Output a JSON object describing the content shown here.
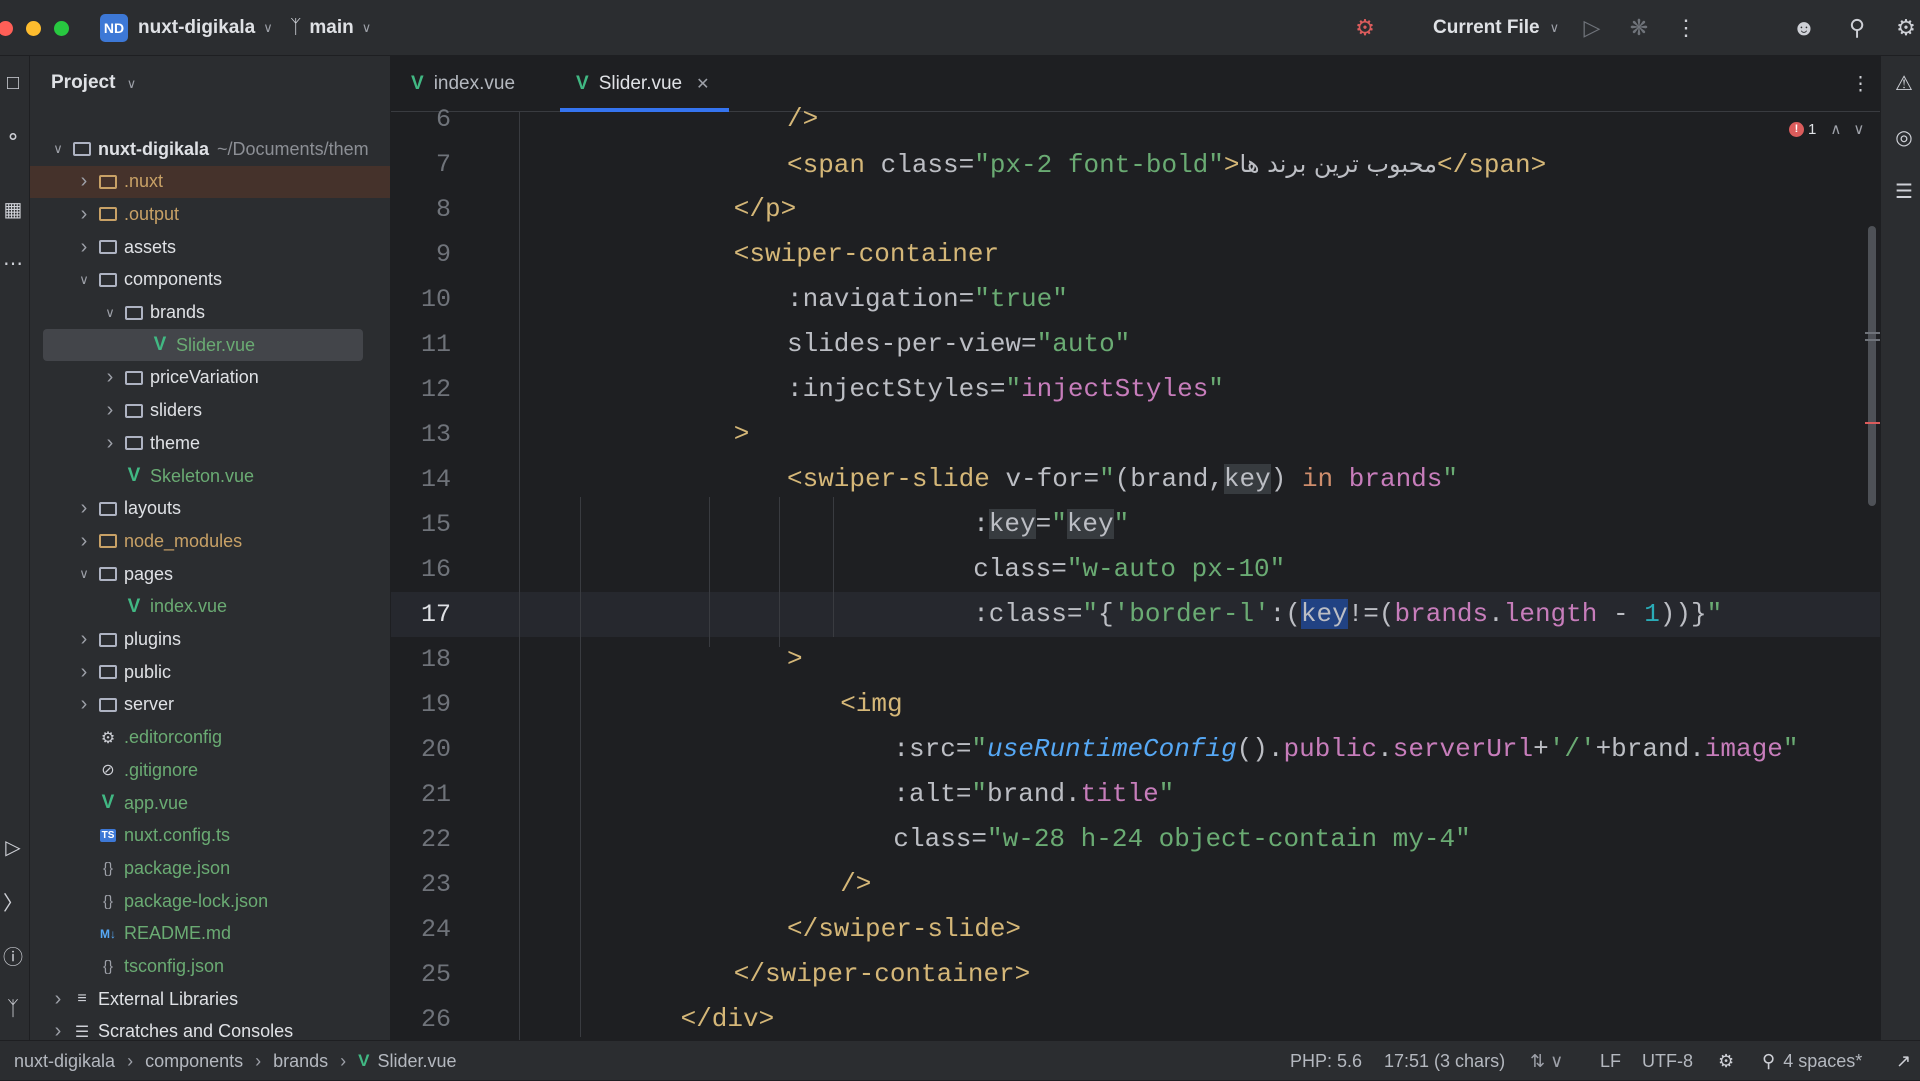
{
  "titlebar": {
    "project_badge": "ND",
    "project_name": "nuxt-digikala",
    "branch": "main",
    "run_config": "Current File",
    "colors": {
      "close": "#ff5f57",
      "minimize": "#febc2e",
      "zoom": "#28c840",
      "badge": "#3d78d6"
    }
  },
  "project_panel": {
    "header": "Project",
    "tree": [
      {
        "label": "nuxt-digikala",
        "suffix": "~/Documents/them",
        "type": "folder",
        "depth": 0,
        "expanded": true,
        "bold": true
      },
      {
        "label": ".nuxt",
        "type": "folder",
        "depth": 1,
        "expanded": false,
        "color": "#c8a166",
        "highlight": true
      },
      {
        "label": ".output",
        "type": "folder",
        "depth": 1,
        "expanded": false,
        "color": "#c8a166"
      },
      {
        "label": "assets",
        "type": "folder",
        "depth": 1,
        "expanded": false
      },
      {
        "label": "components",
        "type": "folder",
        "depth": 1,
        "expanded": true
      },
      {
        "label": "brands",
        "type": "folder",
        "depth": 2,
        "expanded": true
      },
      {
        "label": "Slider.vue",
        "type": "vue",
        "depth": 3,
        "selected": true,
        "color": "#6aab73"
      },
      {
        "label": "priceVariation",
        "type": "folder",
        "depth": 2,
        "expanded": false
      },
      {
        "label": "sliders",
        "type": "folder",
        "depth": 2,
        "expanded": false
      },
      {
        "label": "theme",
        "type": "folder",
        "depth": 2,
        "expanded": false
      },
      {
        "label": "Skeleton.vue",
        "type": "vue",
        "depth": 2,
        "color": "#6aab73"
      },
      {
        "label": "layouts",
        "type": "folder",
        "depth": 1,
        "expanded": false
      },
      {
        "label": "node_modules",
        "type": "folder",
        "depth": 1,
        "expanded": false,
        "color": "#c8a166"
      },
      {
        "label": "pages",
        "type": "folder",
        "depth": 1,
        "expanded": true
      },
      {
        "label": "index.vue",
        "type": "vue",
        "depth": 2,
        "color": "#6aab73"
      },
      {
        "label": "plugins",
        "type": "folder",
        "depth": 1,
        "expanded": false
      },
      {
        "label": "public",
        "type": "folder",
        "depth": 1,
        "expanded": false
      },
      {
        "label": "server",
        "type": "folder",
        "depth": 1,
        "expanded": false
      },
      {
        "label": ".editorconfig",
        "type": "gear",
        "depth": 1,
        "color": "#6aab73"
      },
      {
        "label": ".gitignore",
        "type": "ban",
        "depth": 1,
        "color": "#6aab73"
      },
      {
        "label": "app.vue",
        "type": "vue",
        "depth": 1,
        "color": "#6aab73"
      },
      {
        "label": "nuxt.config.ts",
        "type": "ts",
        "depth": 1,
        "color": "#6aab73"
      },
      {
        "label": "package.json",
        "type": "json",
        "depth": 1,
        "color": "#6aab73"
      },
      {
        "label": "package-lock.json",
        "type": "json",
        "depth": 1,
        "color": "#6aab73"
      },
      {
        "label": "README.md",
        "type": "md",
        "depth": 1,
        "color": "#6aab73"
      },
      {
        "label": "tsconfig.json",
        "type": "json",
        "depth": 1,
        "color": "#6aab73"
      },
      {
        "label": "External Libraries",
        "type": "lib",
        "depth": 0,
        "expanded": false
      },
      {
        "label": "Scratches and Consoles",
        "type": "scratch",
        "depth": 0,
        "expanded": false
      }
    ]
  },
  "tabs": [
    {
      "label": "index.vue",
      "active": false
    },
    {
      "label": "Slider.vue",
      "active": true
    }
  ],
  "editor": {
    "error_count": "1",
    "current_line": "17",
    "lines": [
      {
        "n": "6",
        "indent": 20,
        "parts": [
          [
            "tag",
            "/>"
          ]
        ]
      },
      {
        "n": "7",
        "indent": 20,
        "parts": [
          [
            "tag",
            "<span "
          ],
          [
            "attr",
            "class"
          ],
          [
            "punct",
            "="
          ],
          [
            "str",
            "\"px-2 font-bold\""
          ],
          [
            "tag",
            ">"
          ],
          [
            "attr",
            "محبوب ترین برند ها"
          ],
          [
            "tag",
            "</span>"
          ]
        ]
      },
      {
        "n": "8",
        "indent": 16,
        "parts": [
          [
            "tag",
            "</p>"
          ]
        ]
      },
      {
        "n": "9",
        "indent": 16,
        "parts": [
          [
            "tag",
            "<swiper-container"
          ]
        ]
      },
      {
        "n": "10",
        "indent": 20,
        "parts": [
          [
            "attr",
            ":navigation"
          ],
          [
            "punct",
            "="
          ],
          [
            "str",
            "\"true\""
          ]
        ]
      },
      {
        "n": "11",
        "indent": 20,
        "parts": [
          [
            "attr",
            "slides-per-view"
          ],
          [
            "punct",
            "="
          ],
          [
            "str",
            "\"auto\""
          ]
        ]
      },
      {
        "n": "12",
        "indent": 20,
        "parts": [
          [
            "attr",
            ":injectStyles"
          ],
          [
            "punct",
            "="
          ],
          [
            "str",
            "\""
          ],
          [
            "var",
            "injectStyles"
          ],
          [
            "str",
            "\""
          ]
        ]
      },
      {
        "n": "13",
        "indent": 16,
        "parts": [
          [
            "tag",
            ">"
          ]
        ]
      },
      {
        "n": "14",
        "indent": 20,
        "parts": [
          [
            "tag",
            "<swiper-slide "
          ],
          [
            "attr",
            "v-for"
          ],
          [
            "punct",
            "="
          ],
          [
            "str",
            "\""
          ],
          [
            "bracket",
            "("
          ],
          [
            "attr",
            "brand,"
          ],
          [
            "hlbox",
            "key"
          ],
          [
            "bracket",
            ")"
          ],
          [
            "punct",
            " "
          ],
          [
            "kw",
            "in"
          ],
          [
            "punct",
            " "
          ],
          [
            "var",
            "brands"
          ],
          [
            "str",
            "\""
          ]
        ]
      },
      {
        "n": "15",
        "indent": 34,
        "parts": [
          [
            "attr",
            ":"
          ],
          [
            "hlbox",
            "key"
          ],
          [
            "punct",
            "="
          ],
          [
            "str",
            "\""
          ],
          [
            "hlbox",
            "key"
          ],
          [
            "str",
            "\""
          ]
        ]
      },
      {
        "n": "16",
        "indent": 34,
        "parts": [
          [
            "attr",
            "class"
          ],
          [
            "punct",
            "="
          ],
          [
            "str",
            "\"w-auto px-10\""
          ]
        ]
      },
      {
        "n": "17",
        "indent": 34,
        "parts": [
          [
            "attr",
            ":class"
          ],
          [
            "punct",
            "="
          ],
          [
            "str",
            "\""
          ],
          [
            "punct",
            "{"
          ],
          [
            "str",
            "'border-l'"
          ],
          [
            "punct",
            ":("
          ],
          [
            "selbox",
            "key"
          ],
          [
            "punct",
            "!=("
          ],
          [
            "var",
            "brands"
          ],
          [
            "punct",
            "."
          ],
          [
            "var",
            "length"
          ],
          [
            "punct",
            " - "
          ],
          [
            "num",
            "1"
          ],
          [
            "punct",
            "))}"
          ],
          [
            "str",
            "\""
          ]
        ]
      },
      {
        "n": "18",
        "indent": 20,
        "parts": [
          [
            "tag",
            ">"
          ]
        ]
      },
      {
        "n": "19",
        "indent": 24,
        "parts": [
          [
            "tag",
            "<img"
          ]
        ]
      },
      {
        "n": "20",
        "indent": 28,
        "parts": [
          [
            "attr",
            ":src"
          ],
          [
            "punct",
            "="
          ],
          [
            "str",
            "\""
          ],
          [
            "fn",
            "useRuntimeConfig"
          ],
          [
            "punct",
            "()."
          ],
          [
            "var",
            "public"
          ],
          [
            "punct",
            "."
          ],
          [
            "var",
            "serverUrl"
          ],
          [
            "punct",
            "+"
          ],
          [
            "str",
            "'/'"
          ],
          [
            "punct",
            "+brand."
          ],
          [
            "var",
            "image"
          ],
          [
            "str",
            "\""
          ]
        ]
      },
      {
        "n": "21",
        "indent": 28,
        "parts": [
          [
            "attr",
            ":alt"
          ],
          [
            "punct",
            "="
          ],
          [
            "str",
            "\""
          ],
          [
            "punct",
            "brand."
          ],
          [
            "var",
            "title"
          ],
          [
            "str",
            "\""
          ]
        ]
      },
      {
        "n": "22",
        "indent": 28,
        "parts": [
          [
            "attr",
            "class"
          ],
          [
            "punct",
            "="
          ],
          [
            "str",
            "\"w-28 h-24 object-contain my-4\""
          ]
        ]
      },
      {
        "n": "23",
        "indent": 24,
        "parts": [
          [
            "tag",
            "/>"
          ]
        ]
      },
      {
        "n": "24",
        "indent": 20,
        "parts": [
          [
            "tag",
            "</swiper-slide>"
          ]
        ]
      },
      {
        "n": "25",
        "indent": 16,
        "parts": [
          [
            "tag",
            "</swiper-container>"
          ]
        ]
      },
      {
        "n": "26",
        "indent": 12,
        "parts": [
          [
            "tag",
            "</div>"
          ]
        ]
      }
    ]
  },
  "statusbar": {
    "breadcrumb": [
      "nuxt-digikala",
      "components",
      "brands",
      "Slider.vue"
    ],
    "php": "PHP: 5.6",
    "position": "17:51 (3 chars)",
    "line_sep": "LF",
    "encoding": "UTF-8",
    "indent": "4 spaces*"
  }
}
